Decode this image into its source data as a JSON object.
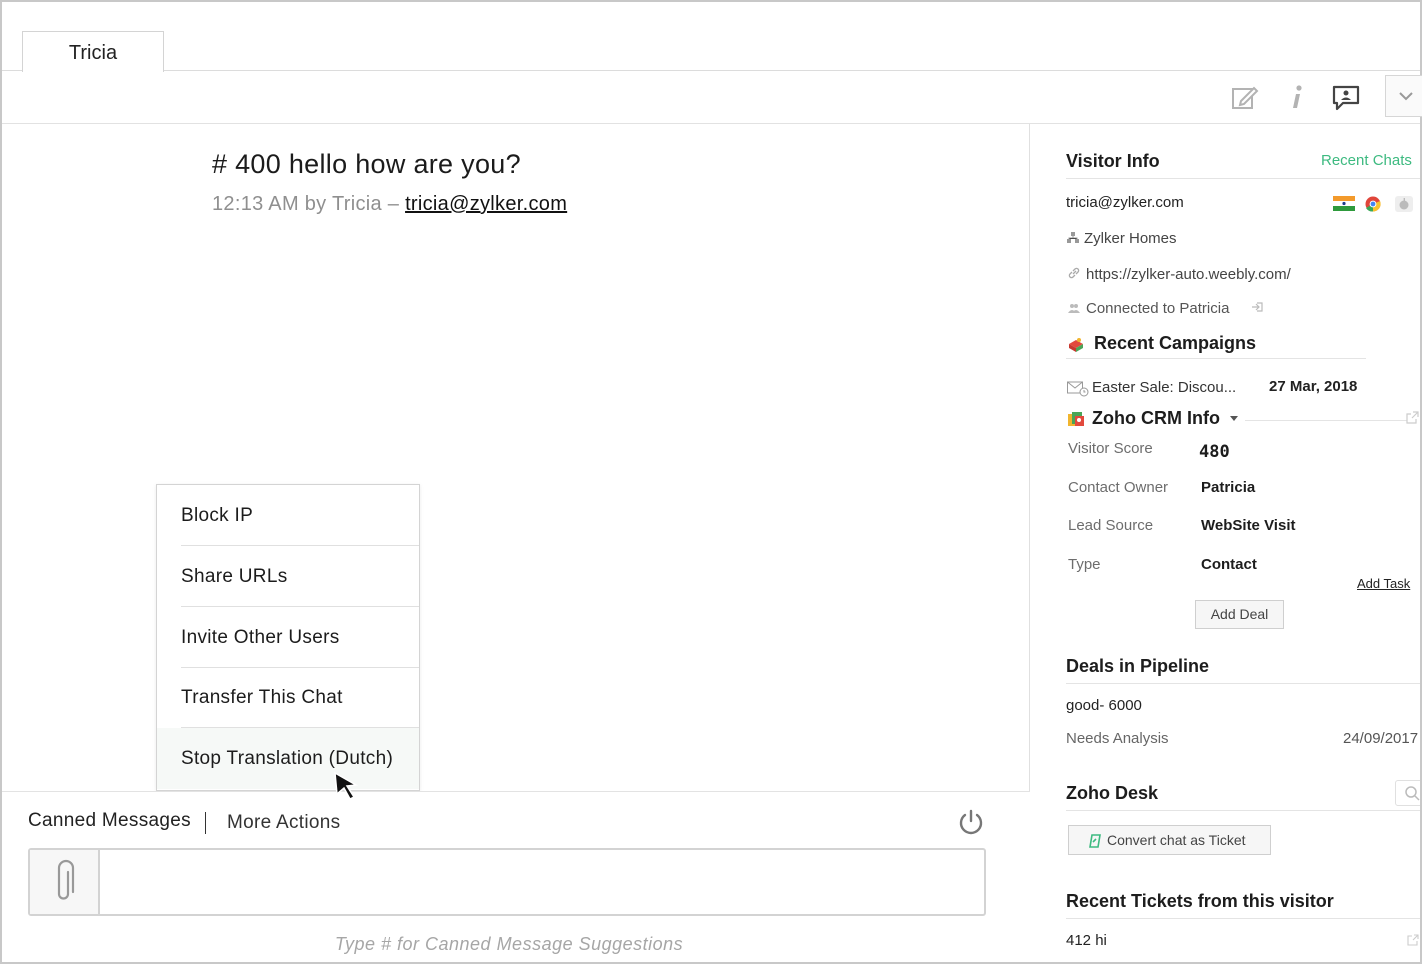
{
  "tab": {
    "label": "Tricia"
  },
  "toolbar": {
    "icons": [
      "edit-icon",
      "info-icon",
      "chat-bubble-icon",
      "chevron-down-icon"
    ]
  },
  "message": {
    "title": "# 400  hello how are you?",
    "meta_prefix": "12:13 AM by Tricia – ",
    "meta_email": "tricia@zylker.com"
  },
  "more_actions_menu": {
    "items": [
      "Block IP",
      "Share URLs",
      "Invite Other Users",
      "Transfer This Chat",
      "Stop Translation (Dutch)"
    ]
  },
  "bottom": {
    "canned_label": "Canned Messages",
    "more_label": "More Actions",
    "hint": "Type # for Canned Message Suggestions"
  },
  "sidebar": {
    "visitor_info": {
      "title": "Visitor Info",
      "recent_chats": "Recent Chats",
      "email": "tricia@zylker.com",
      "company": "Zylker Homes",
      "url": "https://zylker-auto.weebly.com/",
      "connected": "Connected to Patricia"
    },
    "campaigns": {
      "title": "Recent Campaigns",
      "name": "Easter Sale: Discou...",
      "date": "27 Mar, 2018"
    },
    "crm": {
      "title": "Zoho CRM Info",
      "rows": [
        {
          "label": "Visitor Score",
          "value": "480"
        },
        {
          "label": "Contact Owner",
          "value": "Patricia"
        },
        {
          "label": "Lead Source",
          "value": "WebSite Visit"
        },
        {
          "label": "Type",
          "value": "Contact"
        }
      ],
      "add_task": "Add Task",
      "add_deal": "Add Deal"
    },
    "deals": {
      "title": "Deals in Pipeline",
      "name": "good- 6000",
      "stage": "Needs Analysis",
      "date": "24/09/2017"
    },
    "desk": {
      "title": "Zoho Desk",
      "convert": "Convert chat as Ticket"
    },
    "tickets": {
      "title": "Recent Tickets from this visitor",
      "item": "412 hi"
    }
  },
  "colors": {
    "accent_green": "#3dba80",
    "border": "#d4d4d4"
  }
}
